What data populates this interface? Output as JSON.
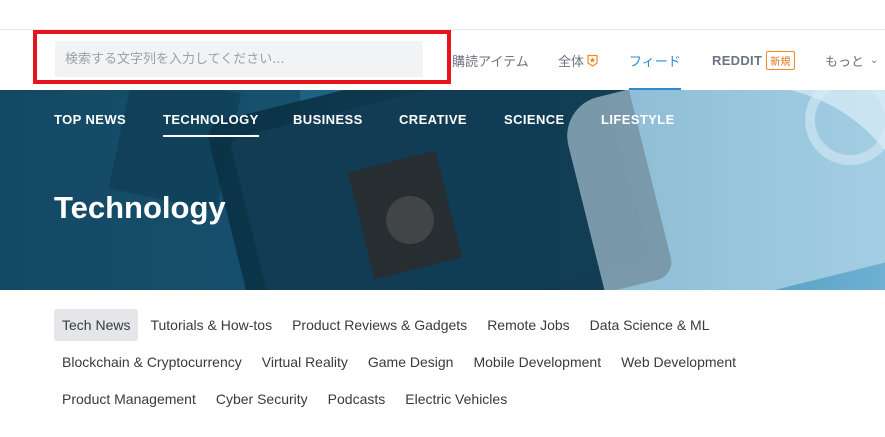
{
  "search": {
    "placeholder": "検索する文字列を入力してください..."
  },
  "nav": {
    "subscribed": "購読アイテム",
    "all": "全体",
    "feed": "フィード",
    "reddit": "REDDIT",
    "reddit_badge": "新規",
    "more": "もっと",
    "active": "feed"
  },
  "categories": {
    "items": [
      "TOP NEWS",
      "TECHNOLOGY",
      "BUSINESS",
      "CREATIVE",
      "SCIENCE",
      "LIFESTYLE"
    ],
    "active": "TECHNOLOGY"
  },
  "hero": {
    "title": "Technology"
  },
  "tags": {
    "rows": [
      [
        "Tech News",
        "Tutorials & How-tos",
        "Product Reviews & Gadgets",
        "Remote Jobs",
        "Data Science & ML"
      ],
      [
        "Blockchain & Cryptocurrency",
        "Virtual Reality",
        "Game Design",
        "Mobile Development",
        "Web Development"
      ],
      [
        "Product Management",
        "Cyber Security",
        "Podcasts",
        "Electric Vehicles"
      ]
    ],
    "active": "Tech News"
  },
  "colors": {
    "accent": "#2a8bd8",
    "highlight_box": "#e8141b",
    "hero_bg": "#1f6486",
    "badge": "#f08a24"
  }
}
